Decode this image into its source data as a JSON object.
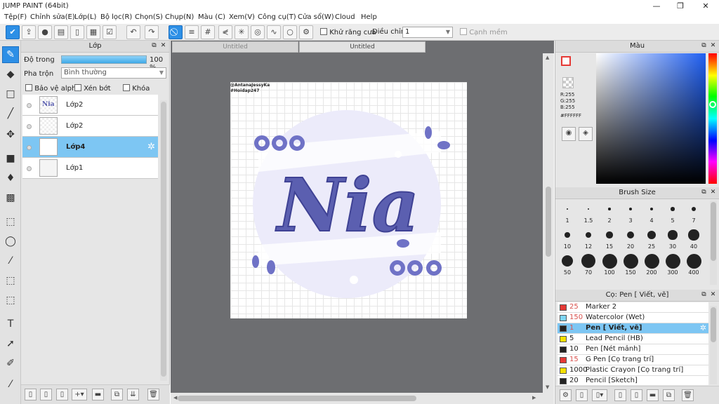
{
  "window": {
    "title": "JUMP PAINT (64bit)",
    "minimize": "—",
    "restore": "❐",
    "close": "✕"
  },
  "menu": [
    "Tệp(F)",
    "Chỉnh sửa(E)",
    "Lớp(L)",
    "Bộ lọc(R)",
    "Chọn(S)",
    "Chụp(N)",
    "Màu (C)",
    "Xem(V)",
    "Công cụ(T)",
    "Cửa sổ(W)",
    "Cloud",
    "Help"
  ],
  "toolbar": {
    "antialias_label": "Khử răng cưa",
    "adjust_label": "Điều chỉnh",
    "adjust_value": "1",
    "snap_label": "Cạnh mềm"
  },
  "layer_panel": {
    "title": "Lớp",
    "opacity_label": "Độ trong",
    "opacity_value": "100 %",
    "opacity": 1.0,
    "blend_label": "Pha trộn",
    "blend_value": "Bình thường",
    "protect_alpha": "Bảo vệ alpha",
    "clipping": "Xén bớt",
    "lock": "Khóa",
    "layers": [
      {
        "name": "Lớp2"
      },
      {
        "name": "Lớp2"
      },
      {
        "name": "Lớp4",
        "selected": true
      },
      {
        "name": "Lớp1"
      }
    ]
  },
  "tabs": [
    {
      "label": "Untitled"
    },
    {
      "label": "Untitled"
    }
  ],
  "canvas": {
    "watermark1": "@AntanaJessyKa",
    "watermark2": "#Hoidap247",
    "art_text": "Nia",
    "accent": "#5b5fb0",
    "bg_circle": "#ecebfa"
  },
  "color_panel": {
    "title": "Màu",
    "r": "R:255",
    "g": "G:255",
    "b": "B:255",
    "hex": "#FFFFFF"
  },
  "brush_size_panel": {
    "title": "Brush Size",
    "sizes": [
      "1",
      "1.5",
      "2",
      "3",
      "4",
      "5",
      "7",
      "10",
      "12",
      "15",
      "20",
      "25",
      "30",
      "40",
      "50",
      "70",
      "100",
      "150",
      "200",
      "300",
      "400"
    ]
  },
  "brush_panel": {
    "title": "Cọ: Pen [ Viết, vẽ]",
    "brushes": [
      {
        "color": "#e53935",
        "size": "25",
        "name": "Marker 2"
      },
      {
        "color": "#7ed6f5",
        "size": "150",
        "name": "Watercolor (Wet)"
      },
      {
        "color": "#222222",
        "size": "1",
        "name": "Pen [ Viết, vẽ]",
        "selected": true
      },
      {
        "color": "#f5e100",
        "size": "5",
        "name": "Lead Pencil (HB)"
      },
      {
        "color": "#222222",
        "size": "10",
        "name": "Pen [Nét mảnh]"
      },
      {
        "color": "#e53935",
        "size": "15",
        "name": "G Pen [Cọ trang trí]"
      },
      {
        "color": "#f5e100",
        "size": "1000",
        "name": "Plastic Crayon [Cọ trang trí]"
      },
      {
        "color": "#222222",
        "size": "20",
        "name": "Pencil [Sketch]"
      }
    ]
  }
}
